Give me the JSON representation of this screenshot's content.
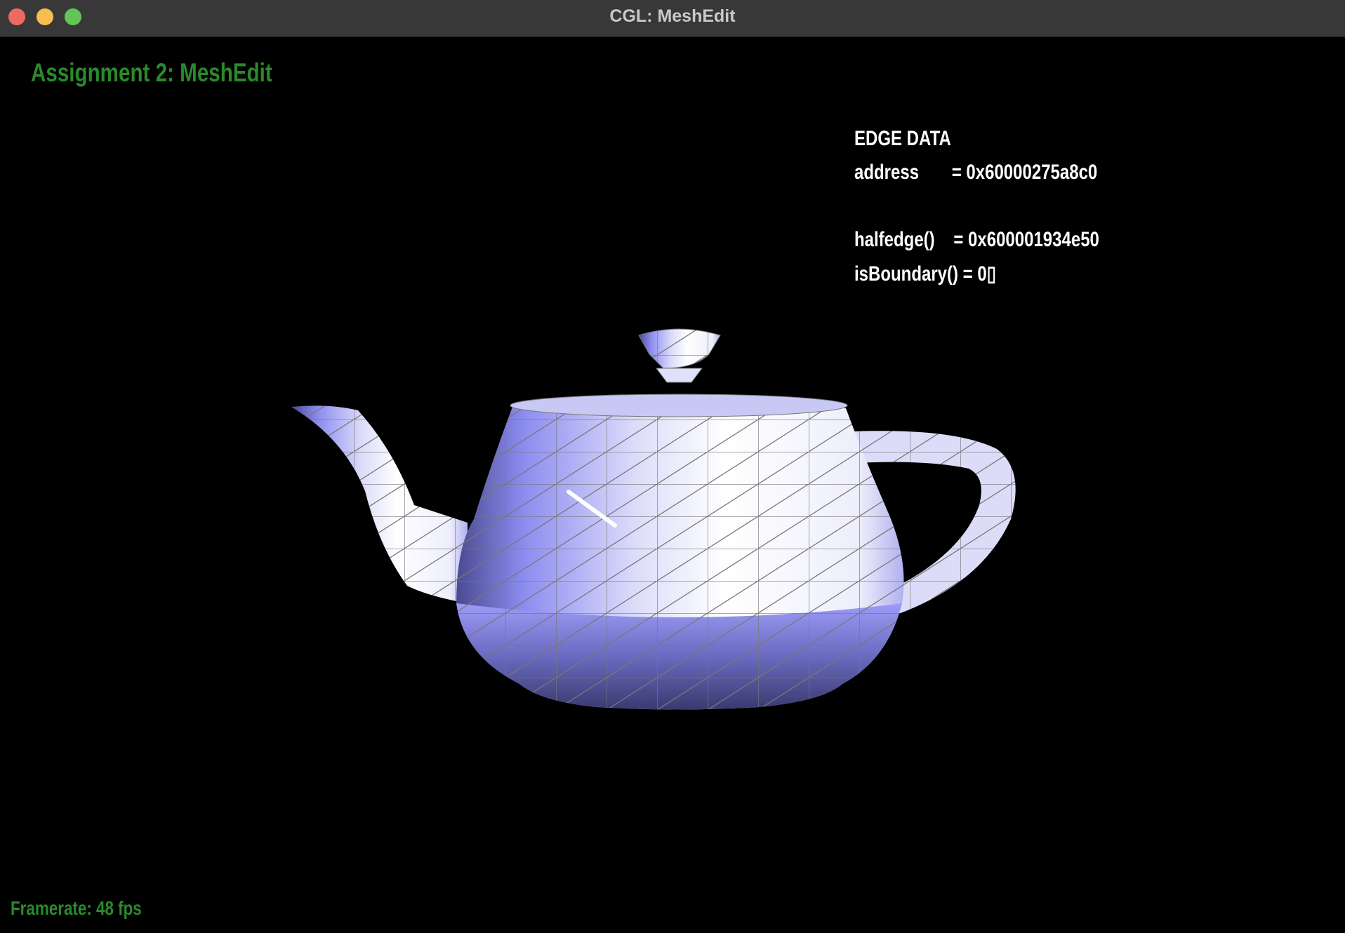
{
  "window": {
    "title": "CGL: MeshEdit",
    "controls": [
      "close",
      "minimize",
      "zoom"
    ]
  },
  "app": {
    "title": "Assignment 2: MeshEdit"
  },
  "edge_data": {
    "heading": "EDGE DATA",
    "address": "address       = 0x60000275a8c0",
    "halfedge": "halfedge()    = 0x600001934e50",
    "is_boundary": "isBoundary() = 0▯"
  },
  "status": {
    "framerate": "Framerate: 48 fps"
  },
  "colors": {
    "accent_green": "#2a8a2a",
    "mesh": "#9a9af5",
    "highlight": "#ffffff"
  }
}
